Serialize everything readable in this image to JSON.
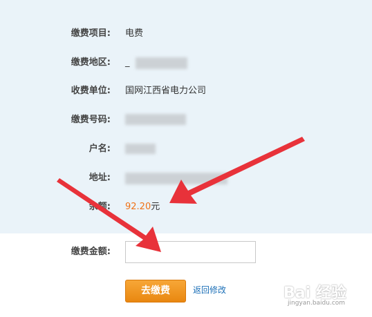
{
  "info": {
    "item_label": "缴费项目:",
    "item_value": "电费",
    "region_label": "缴费地区:",
    "region_value": "_",
    "unit_label": "收费单位:",
    "unit_value": "国网江西省电力公司",
    "number_label": "缴费号码:",
    "name_label": "户名:",
    "address_label": "地址:",
    "balance_label": "余额:",
    "balance_amount": "92.20",
    "balance_unit": "元"
  },
  "form": {
    "amount_label": "缴费金额:",
    "amount_value": "",
    "pay_label": "去缴费",
    "back_label": "返回修改"
  },
  "watermark": {
    "logo": "Bai 经验",
    "sub": "jingyan.baidu.com"
  },
  "colors": {
    "panel_bg": "#eaf3f9",
    "balance": "#f07217",
    "button": "#f09a25",
    "link": "#1b6fb7",
    "arrow": "#e8323a"
  },
  "annotation": {
    "arrow_count": 2
  }
}
